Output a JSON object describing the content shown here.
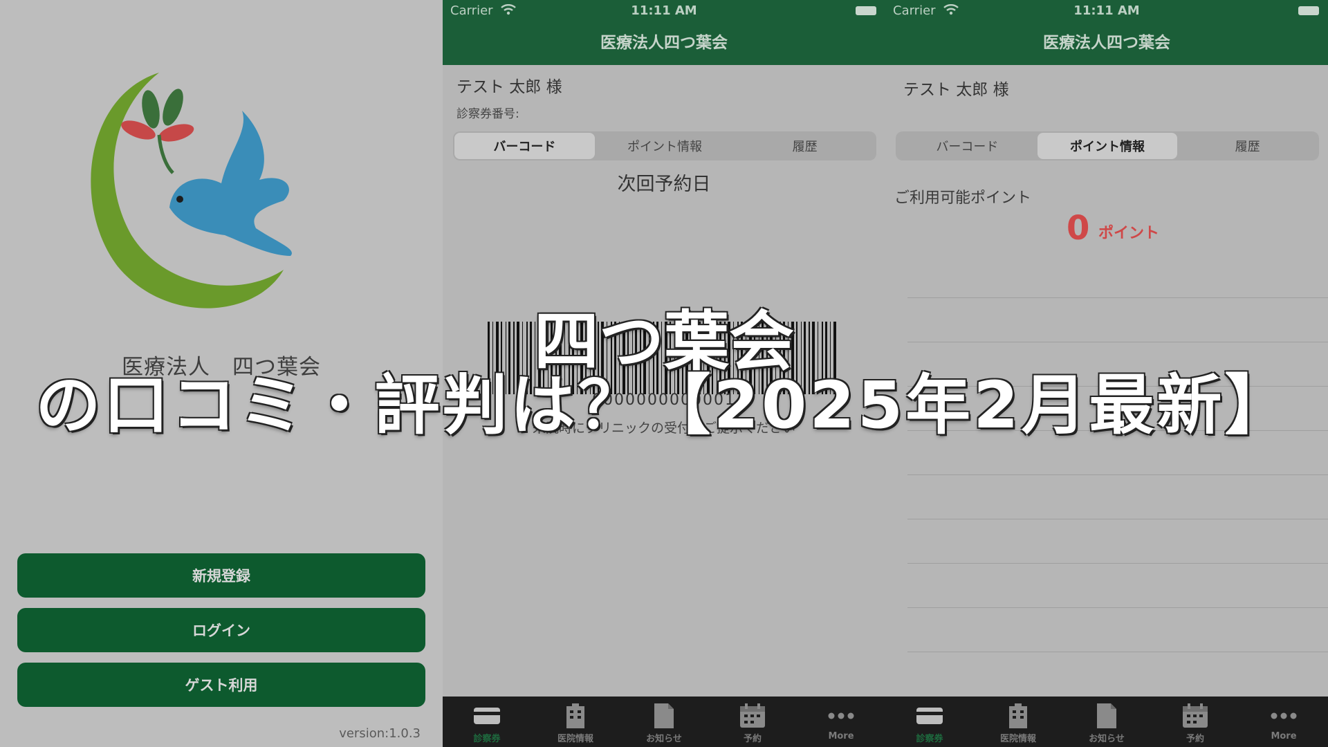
{
  "colors": {
    "brand_green": "#1b5e38",
    "button_green": "#0d5a2e",
    "point_red": "#cf4848",
    "tab_bg": "#1d1d1d"
  },
  "panel1": {
    "org_name": "医療法人　四つ葉会",
    "buttons": [
      "新規登録",
      "ログイン",
      "ゲスト利用"
    ],
    "version": "version:1.0.3"
  },
  "status": {
    "carrier": "Carrier",
    "time": "11:11 AM"
  },
  "panel2": {
    "nav_title": "医療法人四つ葉会",
    "user_name": "テスト 太郎 様",
    "card_label": "診察券番号:",
    "segments": [
      "バーコード",
      "ポイント情報",
      "履歴"
    ],
    "active_segment": 0,
    "next_reservation": "次回予約日",
    "barcode_number": "0000000000001",
    "barcode_note": "来院時にクリニックの受付でご提示ください"
  },
  "panel3": {
    "nav_title": "医療法人四つ葉会",
    "user_name": "テスト 太郎 様",
    "segments": [
      "バーコード",
      "ポイント情報",
      "履歴"
    ],
    "active_segment": 1,
    "points_label": "ご利用可能ポイント",
    "points_value": "0",
    "points_unit": "ポイント"
  },
  "tabbar": {
    "items": [
      {
        "label": "診察券",
        "icon": "card-icon"
      },
      {
        "label": "医院情報",
        "icon": "building-icon"
      },
      {
        "label": "お知らせ",
        "icon": "document-icon"
      },
      {
        "label": "予約",
        "icon": "calendar-icon"
      },
      {
        "label": "More",
        "icon": "more-icon"
      }
    ]
  },
  "overlay": {
    "line1": "四つ葉会",
    "line2": "の口コミ・評判は？【2025年2月最新】"
  }
}
